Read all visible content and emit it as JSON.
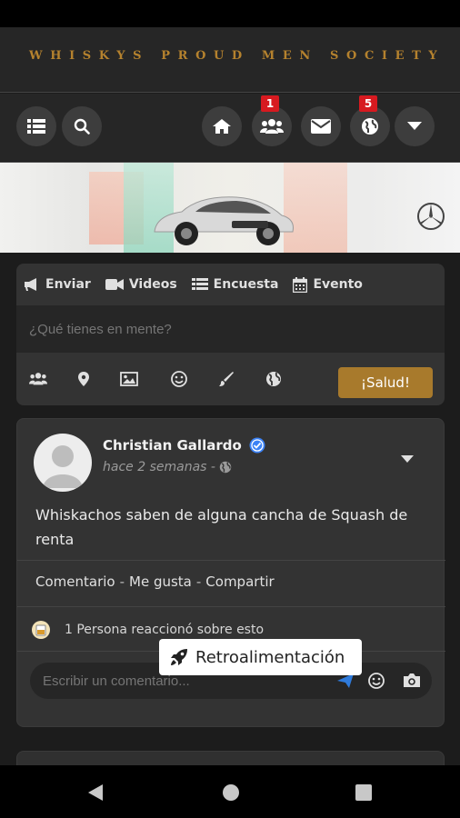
{
  "header": {
    "title": "WHISKYS PROUD MEN SOCIETY"
  },
  "nav": {
    "badges": {
      "friends": "1",
      "notifications": "5"
    }
  },
  "composer": {
    "tabs": [
      {
        "label": "Enviar",
        "icon": "megaphone-icon"
      },
      {
        "label": "Videos",
        "icon": "video-icon"
      },
      {
        "label": "Encuesta",
        "icon": "list-icon"
      },
      {
        "label": "Evento",
        "icon": "calendar-icon"
      }
    ],
    "placeholder": "¿Qué tienes en mente?",
    "tools": [
      "group-icon",
      "location-icon",
      "image-icon",
      "emoji-icon",
      "paintbrush-icon",
      "globe-icon"
    ],
    "submit_label": "¡Salud!"
  },
  "post": {
    "author": "Christian Gallardo",
    "timestamp": "hace 2 semanas -",
    "text": "Whiskachos saben de alguna cancha de Squash de renta",
    "actions": {
      "comment": "Comentario",
      "like": "Me gusta",
      "share": "Compartir"
    },
    "reaction_summary": "1 Persona reaccionó sobre esto",
    "comment_placeholder": "Escribir un comentario..."
  },
  "feedback_tooltip": "Retroalimentación",
  "colors": {
    "accent": "#b5822e",
    "button": "#a87a2c",
    "badge": "#d71a20",
    "verified": "#3b82f6"
  }
}
